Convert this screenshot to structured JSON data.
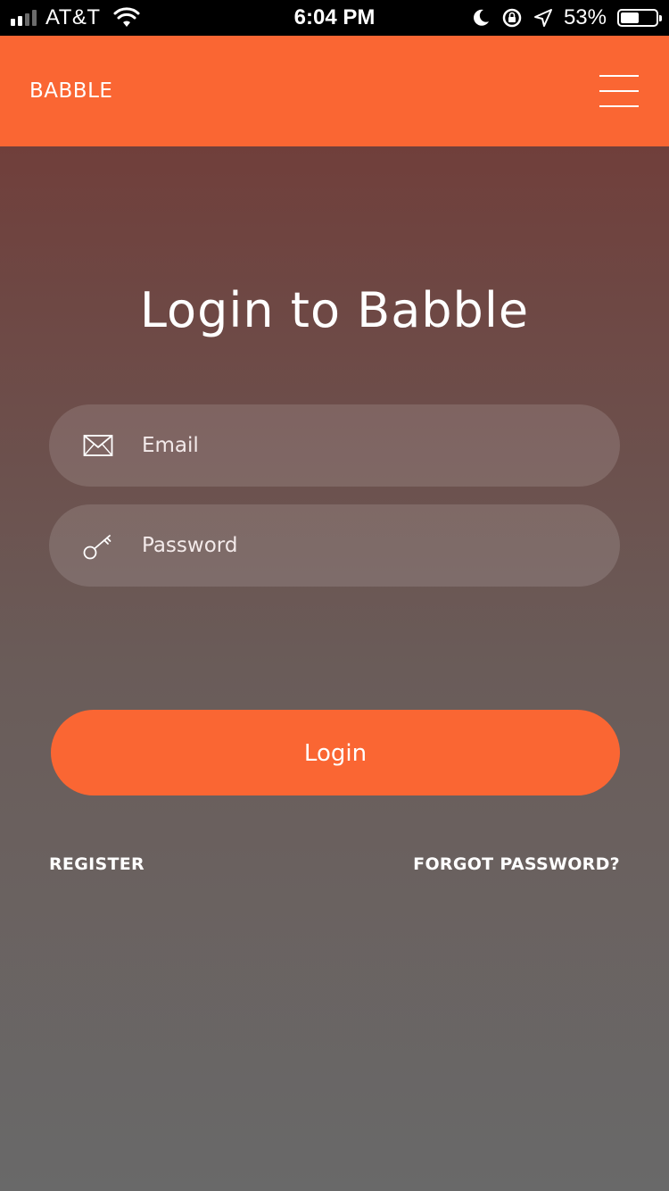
{
  "status_bar": {
    "carrier": "AT&T",
    "time": "6:04 PM",
    "battery_percent": "53%",
    "battery_level": 0.53,
    "icons": [
      "signal-icon",
      "wifi-icon",
      "moon-icon",
      "rotation-lock-icon",
      "location-arrow-icon",
      "battery-icon"
    ]
  },
  "header": {
    "brand": "BABBLE",
    "menu_icon": "hamburger-menu-icon",
    "background_color": "#fa6633"
  },
  "login": {
    "title": "Login to Babble",
    "email": {
      "placeholder": "Email",
      "value": "",
      "icon": "envelope-icon"
    },
    "password": {
      "placeholder": "Password",
      "value": "",
      "icon": "key-icon"
    },
    "submit_label": "Login"
  },
  "links": {
    "register": "REGISTER",
    "forgot_password": "FORGOT PASSWORD?"
  },
  "colors": {
    "accent": "#fa6633",
    "gradient_top": "#703f3b",
    "gradient_bottom": "#696969"
  }
}
